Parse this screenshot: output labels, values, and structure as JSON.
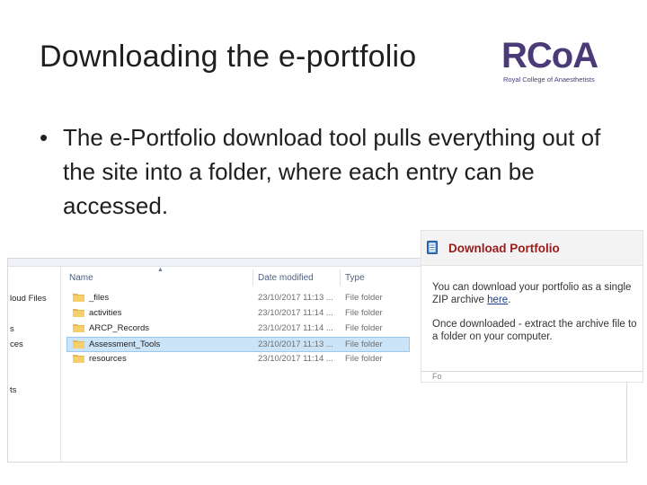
{
  "slide": {
    "title": "Downloading the e-portfolio",
    "bullet_symbol": "•",
    "bullet_text": "The e-Portfolio download tool pulls everything out of the site into a folder, where each entry can be accessed."
  },
  "logo": {
    "wordmark": "RCoA",
    "subtitle": "Royal College of Anaesthetists",
    "color": "#4a3a78"
  },
  "explorer": {
    "nav_items": [
      "loud Files",
      "s",
      "ces",
      "ts"
    ],
    "columns": {
      "name": "Name",
      "date": "Date modified",
      "type": "Type"
    },
    "rows": [
      {
        "name": "_files",
        "date": "23/10/2017 11:13 ...",
        "type": "File folder",
        "selected": false
      },
      {
        "name": "activities",
        "date": "23/10/2017 11:14 ...",
        "type": "File folder",
        "selected": false
      },
      {
        "name": "ARCP_Records",
        "date": "23/10/2017 11:14 ...",
        "type": "File folder",
        "selected": false
      },
      {
        "name": "Assessment_Tools",
        "date": "23/10/2017 11:13 ...",
        "type": "File folder",
        "selected": true
      },
      {
        "name": "resources",
        "date": "23/10/2017 11:14 ...",
        "type": "File folder",
        "selected": false
      }
    ],
    "folder_icon": "folder-icon",
    "folder_color": "#e8b84a",
    "selection_color": "#cce4f7"
  },
  "download_panel": {
    "title": "Download Portfolio",
    "title_color": "#9b1b1b",
    "line1_before": "You can download your portfolio as a single ZIP archive ",
    "link": "here",
    "line1_after": ".",
    "line2": "Once downloaded - extract the archive file to a folder on your computer.",
    "footer_mark": "Fo"
  }
}
